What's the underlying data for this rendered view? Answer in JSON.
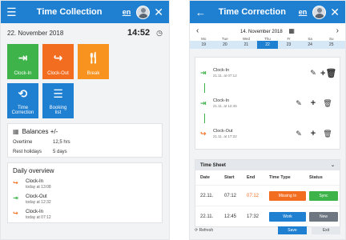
{
  "left": {
    "header": {
      "title": "Time Collection",
      "lang": "en"
    },
    "date": "22. November 2018",
    "time": "14:52",
    "tiles": [
      {
        "label": "Clock-In"
      },
      {
        "label": "Clock-Out"
      },
      {
        "label": "Break"
      },
      {
        "label1": "Time",
        "label2": "Correction"
      },
      {
        "label1": "Booking",
        "label2": "list"
      }
    ],
    "balances": {
      "title": "Balances +/-",
      "rows": [
        {
          "k": "Overtime",
          "v": "12,5 hrs"
        },
        {
          "k": "Rest holidays",
          "v": "5 days"
        }
      ]
    },
    "overview": {
      "title": "Daily overview",
      "items": [
        {
          "label": "Clock-In",
          "time": "today at 13:08"
        },
        {
          "label": "Clock-Out",
          "time": "today at 12:32"
        },
        {
          "label": "Clock-In",
          "time": "today at 07:12"
        }
      ]
    }
  },
  "right": {
    "header": {
      "title": "Time Correction",
      "lang": "en"
    },
    "week": "14. November 2018",
    "days": [
      "Mo",
      "Tue",
      "Wed",
      "Thu",
      "Fr",
      "Sa",
      "Su"
    ],
    "dates": [
      "19",
      "20",
      "21",
      "22",
      "23",
      "24",
      "25"
    ],
    "entries": [
      {
        "label": "Clock-In",
        "time": "21.11. at 07:12"
      },
      {
        "label": "Clock-In",
        "time": "21.11. at 12:45"
      },
      {
        "label": "Clock-Out",
        "time": "21.11. at 17:32"
      }
    ],
    "sheet": {
      "title": "Time Sheet",
      "cols": [
        "Date",
        "Start",
        "End",
        "Time Type",
        "Status"
      ],
      "rows": [
        {
          "date": "22.11.",
          "start": "07:12",
          "end": "07:12",
          "type": "Missing In",
          "status": "Sync"
        },
        {
          "date": "22.11.",
          "start": "12:45",
          "end": "17:32",
          "type": "Work",
          "status": "New"
        }
      ]
    },
    "footer": {
      "refresh": "Refresh",
      "save": "Save",
      "exit": "Exit"
    }
  }
}
